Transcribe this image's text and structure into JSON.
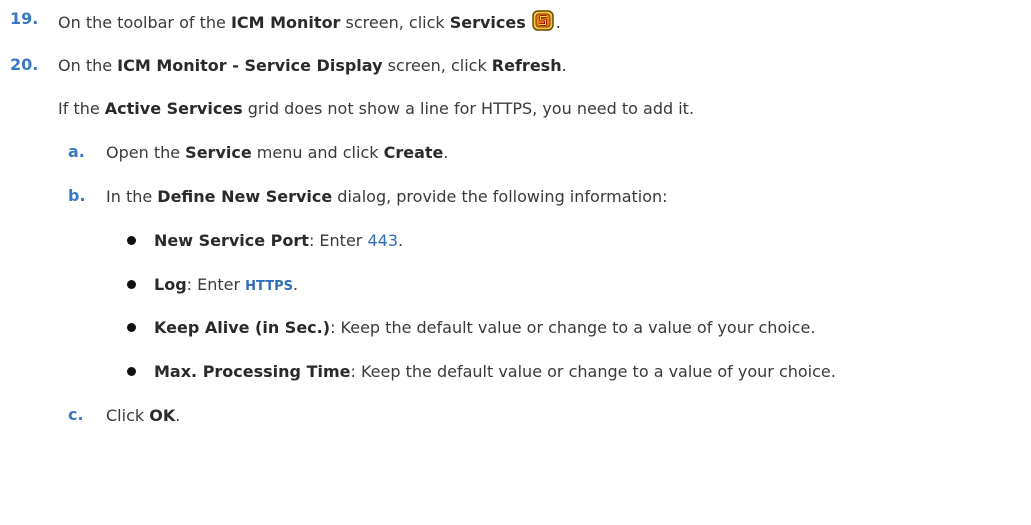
{
  "steps": {
    "s19": {
      "num": "19.",
      "t1": "On the toolbar of the ",
      "b1": "ICM Monitor",
      "t2": " screen, click ",
      "b2": "Services",
      "t3": ".",
      "icon": "services-icon"
    },
    "s20": {
      "num": "20.",
      "t1": "On the ",
      "b1": "ICM Monitor - Service Display",
      "t2": " screen, click ",
      "b2": "Refresh",
      "t3": "."
    },
    "note": {
      "t1": "If the ",
      "b1": "Active Services",
      "t2": " grid does not show a line for HTTPS, you need to add it."
    },
    "a": {
      "num": "a.",
      "t1": "Open the ",
      "b1": "Service",
      "t2": " menu and click ",
      "b2": "Create",
      "t3": "."
    },
    "b": {
      "num": "b.",
      "t1": "In the ",
      "b1": "Define New Service",
      "t2": " dialog, provide the following information:"
    },
    "bullets": [
      {
        "b1": "New Service Port",
        "t1": ": Enter ",
        "code": "443",
        "t2": "."
      },
      {
        "b1": "Log",
        "t1": ": Enter ",
        "code": "HTTPS",
        "t2": "."
      },
      {
        "b1": "Keep Alive (in Sec.)",
        "t1": ": Keep the default value or change to a value of your choice."
      },
      {
        "b1": "Max. Processing Time",
        "t1": ": Keep the default value or change to a value of your choice."
      }
    ],
    "c": {
      "num": "c.",
      "t1": "Click ",
      "b1": "OK",
      "t2": "."
    }
  },
  "colors": {
    "step_number": "#3a78c2",
    "code_text": "#2f6fb7",
    "body_text": "#3a3a3a"
  }
}
